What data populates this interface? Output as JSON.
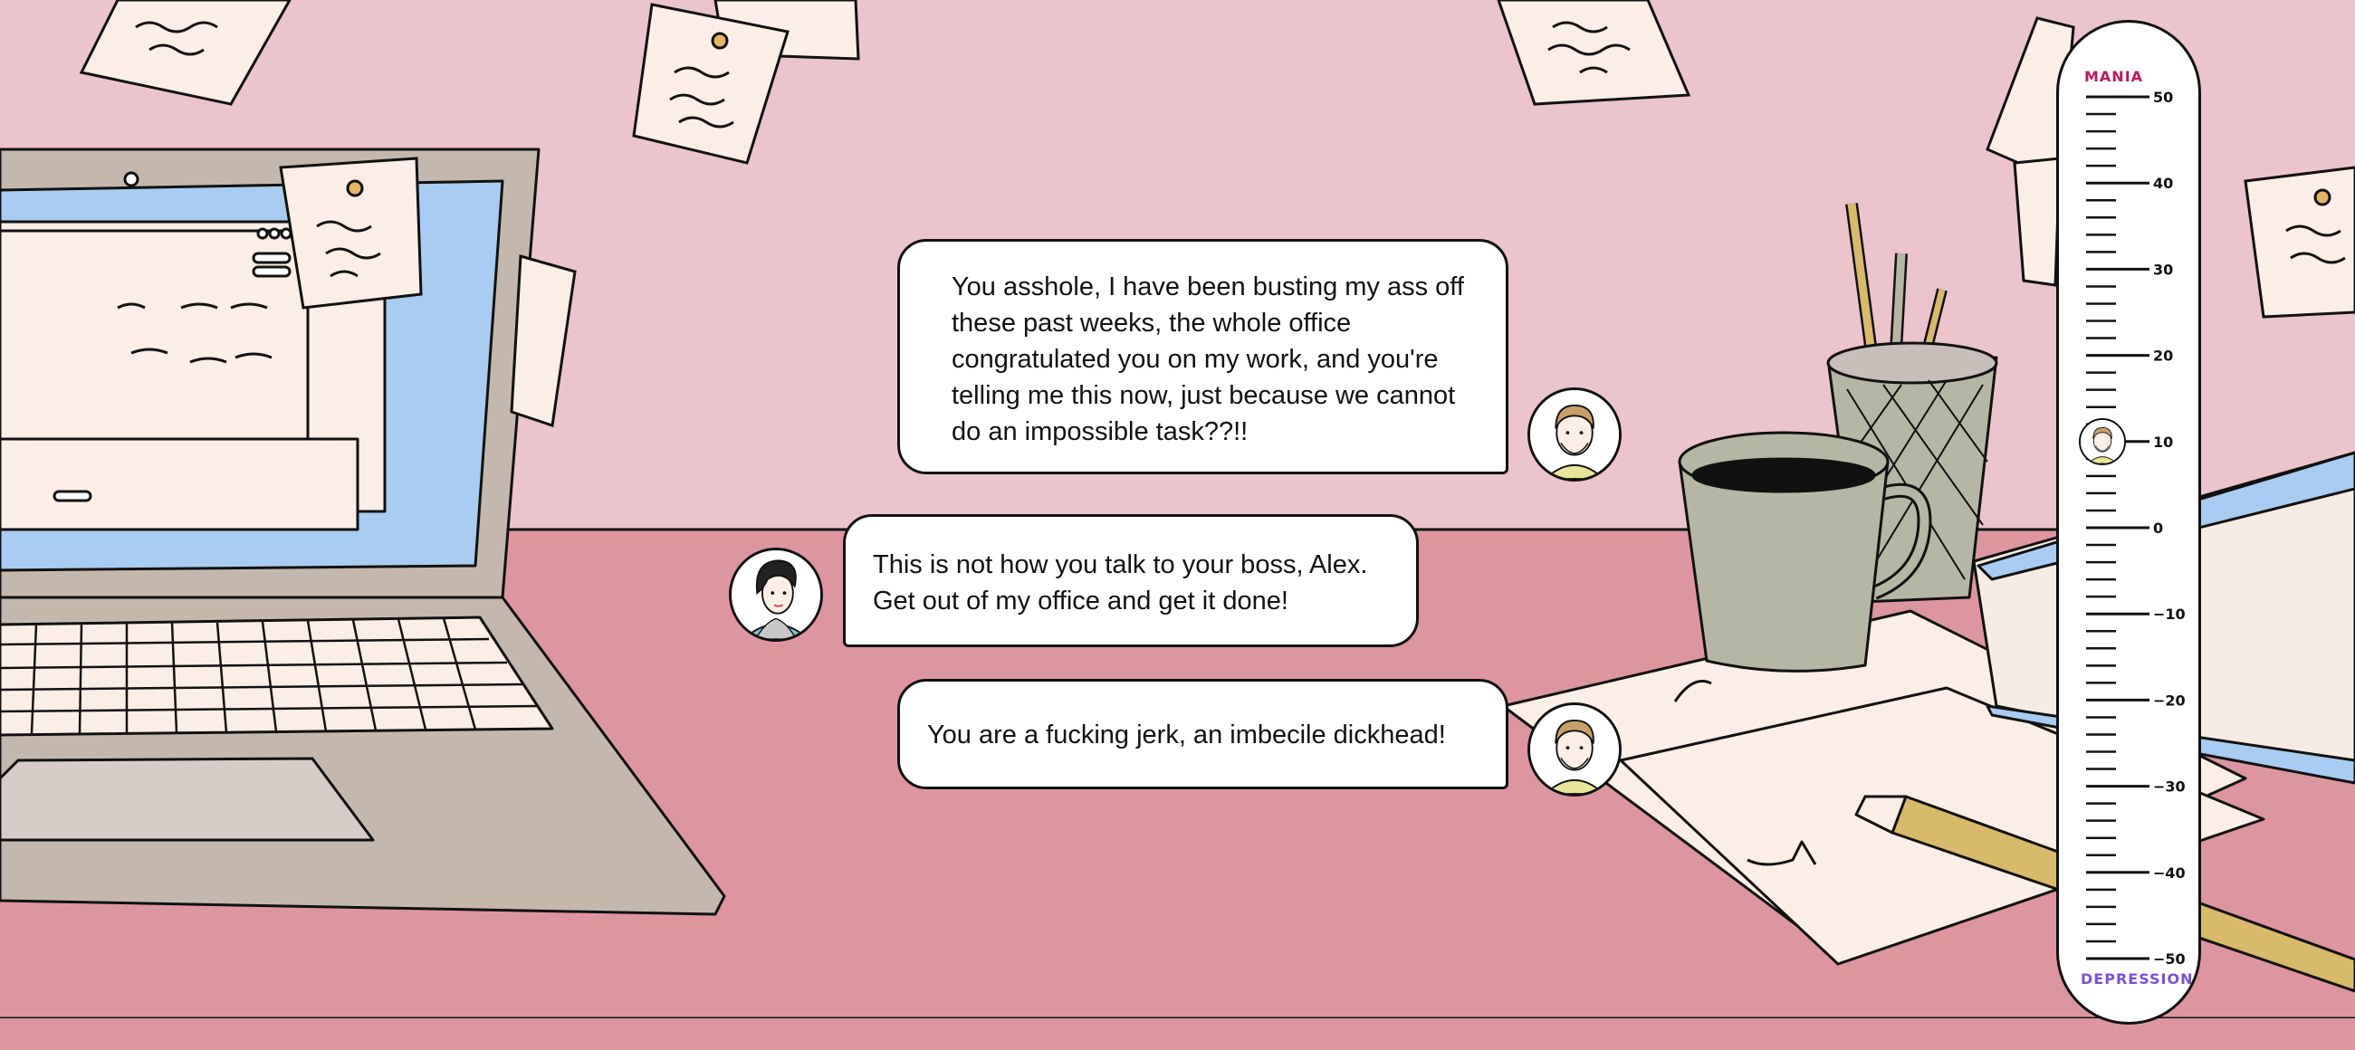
{
  "dialogue": [
    {
      "speaker": "Alex",
      "side": "right",
      "text": "You asshole, I have been busting my ass off these past weeks, the whole office congratulated you on my work, and you're telling me this now, just because we cannot do an impossible task??!!"
    },
    {
      "speaker": "Boss",
      "side": "left",
      "text": "This is not how you talk to your boss, Alex. Get out of my office and get it done!"
    },
    {
      "speaker": "Alex",
      "side": "right",
      "text": "You are a fucking jerk, an imbecile dickhead!"
    }
  ],
  "meter": {
    "top_label": "MANIA",
    "bottom_label": "DEPRESSION",
    "top_color": "#c2185b",
    "bottom_color": "#7b4fd6",
    "max": 50,
    "min": -50,
    "ticks": [
      "50",
      "40",
      "30",
      "20",
      "10",
      "0",
      "−10",
      "−20",
      "−30",
      "−40",
      "−50"
    ],
    "current_value": 10
  },
  "colors": {
    "wall": "#ecc4cc",
    "desk": "#dd96a0",
    "laptop": "#c4b8ae",
    "screen": "#a8ccf2",
    "paper": "#fbeee6",
    "mug": "#b6b6a4",
    "book": "#a8ccf2"
  }
}
